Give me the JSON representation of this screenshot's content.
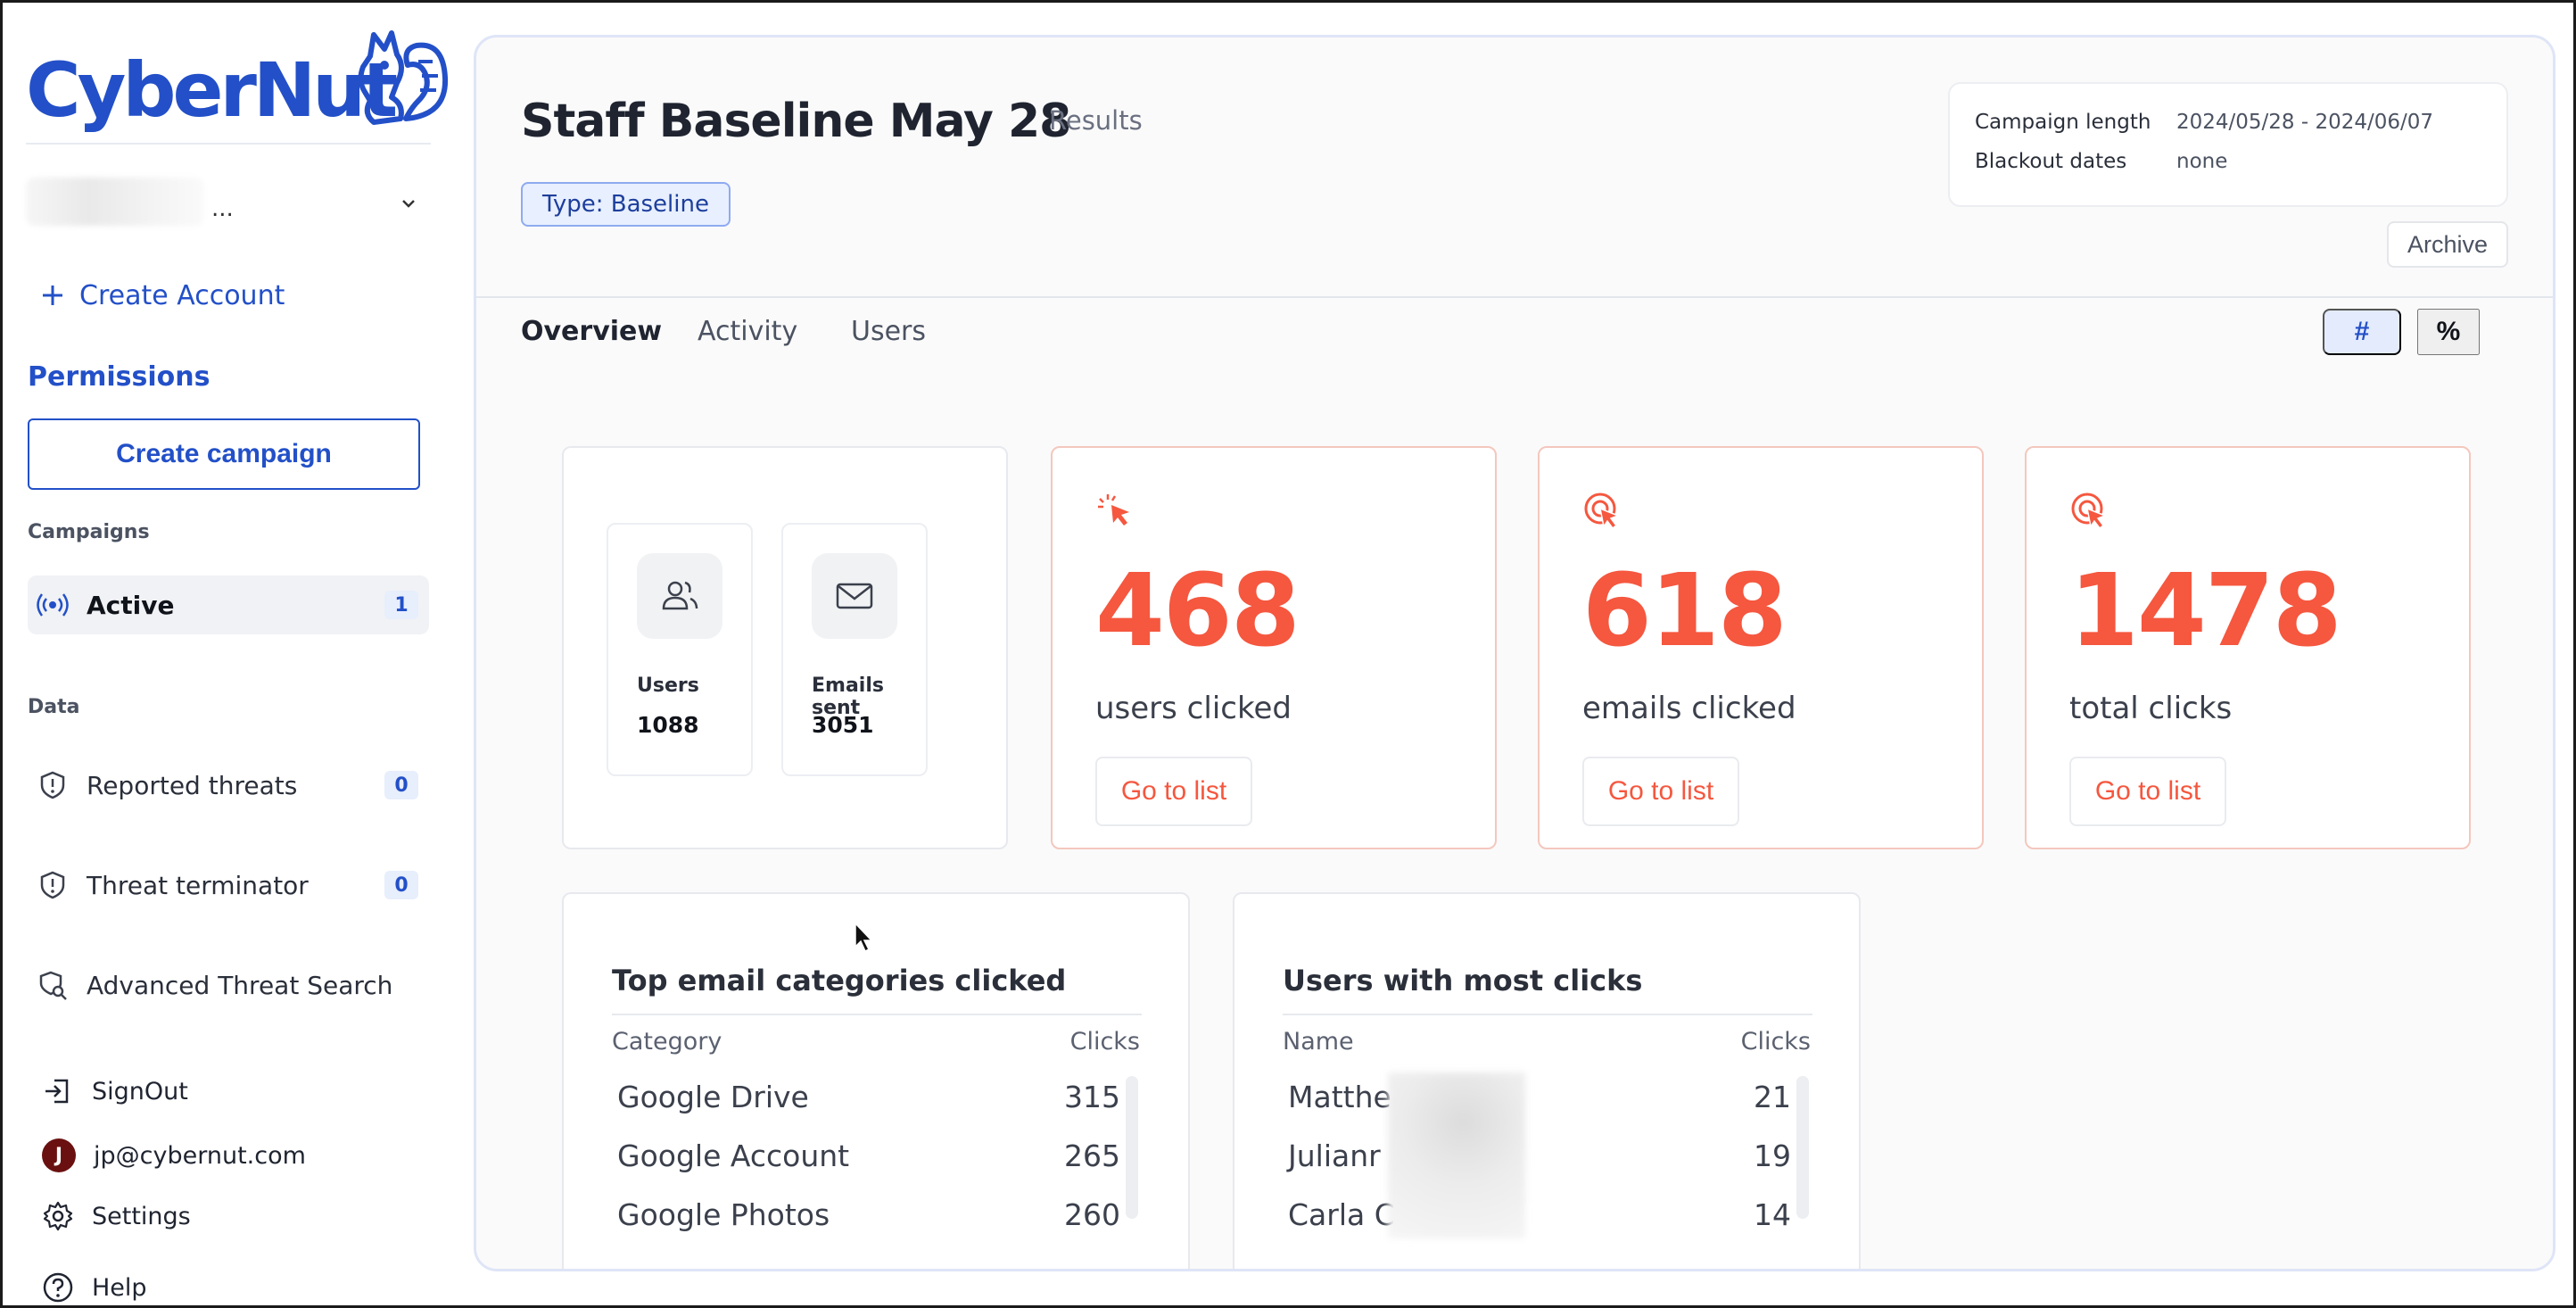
{
  "brand": {
    "name": "CyberNut",
    "primary_color": "#2350c8",
    "accent_color": "#f5573f"
  },
  "sidebar": {
    "account_selector": {
      "value": "...",
      "icon": "chevron-down-icon"
    },
    "create_account": "Create Account",
    "permissions": "Permissions",
    "create_campaign": "Create campaign",
    "campaigns_label": "Campaigns",
    "campaigns": [
      {
        "label": "Active",
        "count": "1",
        "icon": "broadcast-icon"
      }
    ],
    "data_label": "Data",
    "data_items": [
      {
        "label": "Reported threats",
        "count": "0",
        "icon": "shield-icon"
      },
      {
        "label": "Threat terminator",
        "count": "0",
        "icon": "shield-icon"
      },
      {
        "label": "Advanced Threat Search",
        "icon": "search-shield-icon"
      }
    ],
    "signout": "SignOut",
    "user": {
      "initial": "J",
      "email": "jp@cybernut.com"
    },
    "settings": "Settings",
    "help": "Help"
  },
  "header": {
    "title": "Staff Baseline May 28",
    "results_link": "Results",
    "type_badge": "Type: Baseline",
    "campaign_length_label": "Campaign length",
    "campaign_length_value": "2024/05/28 - 2024/06/07",
    "blackout_label": "Blackout dates",
    "blackout_value": "none",
    "archive": "Archive"
  },
  "tabs": [
    "Overview",
    "Activity",
    "Users"
  ],
  "toggle": {
    "count": "#",
    "percent": "%"
  },
  "summary": {
    "users_label": "Users",
    "users_value": "1088",
    "emails_label": "Emails sent",
    "emails_value": "3051"
  },
  "stats": [
    {
      "value": "468",
      "label": "users clicked",
      "button": "Go to list",
      "icon": "cursor-click-icon"
    },
    {
      "value": "618",
      "label": "emails clicked",
      "button": "Go to list",
      "icon": "target-click-icon"
    },
    {
      "value": "1478",
      "label": "total clicks",
      "button": "Go to list",
      "icon": "target-click-icon"
    }
  ],
  "top_categories": {
    "title": "Top email categories clicked",
    "col_category": "Category",
    "col_clicks": "Clicks",
    "rows": [
      {
        "label": "Google Drive",
        "clicks": "315"
      },
      {
        "label": "Google Account",
        "clicks": "265"
      },
      {
        "label": "Google Photos",
        "clicks": "260"
      }
    ]
  },
  "top_users": {
    "title": "Users with most clicks",
    "col_name": "Name",
    "col_clicks": "Clicks",
    "rows": [
      {
        "label": "Matthe",
        "clicks": "21"
      },
      {
        "label": "Julianr",
        "clicks": "19"
      },
      {
        "label": "Carla C",
        "clicks": "14"
      }
    ]
  }
}
